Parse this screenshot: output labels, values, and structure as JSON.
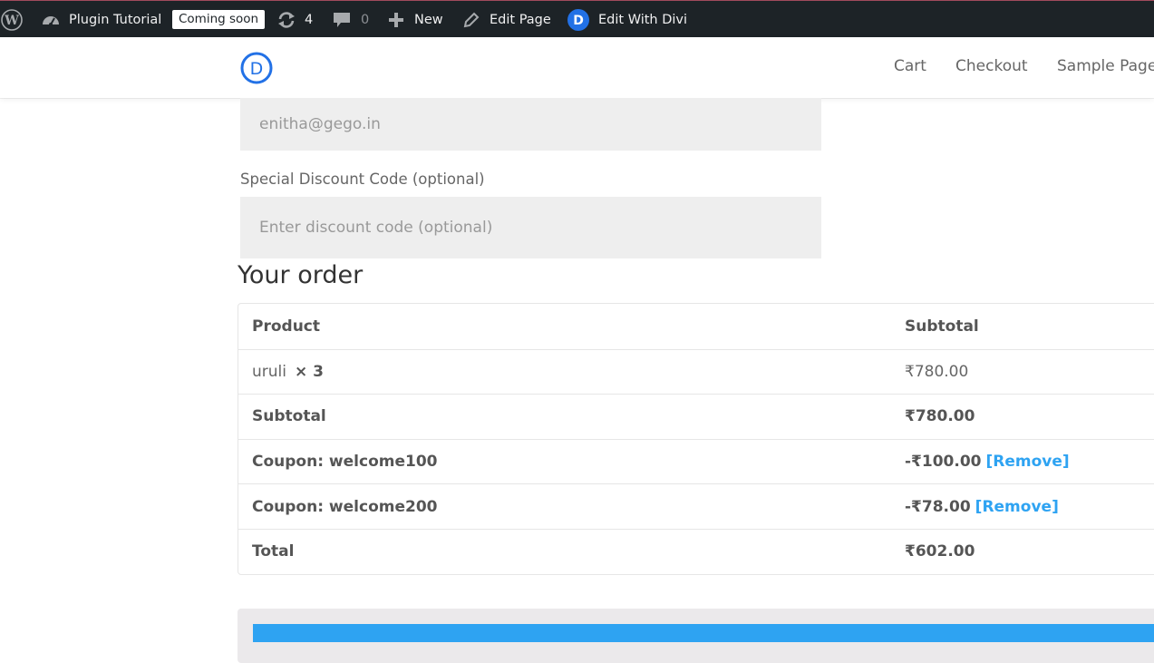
{
  "adminbar": {
    "site_name": "Plugin Tutorial",
    "coming_soon": "Coming soon",
    "updates_count": "4",
    "comments_count": "0",
    "new_label": "New",
    "edit_page_label": "Edit Page",
    "divi_label": "Edit With Divi",
    "colors": {
      "background": "#1d2327",
      "divi_blue": "#2271e6"
    }
  },
  "header": {
    "logo_letter": "D",
    "nav": [
      "Cart",
      "Checkout",
      "Sample Page"
    ]
  },
  "form": {
    "email_value": "enitha@gego.in",
    "discount_label": "Special Discount Code (optional)",
    "discount_placeholder": "Enter discount code (optional)"
  },
  "order": {
    "heading": "Your order",
    "col_product": "Product",
    "col_subtotal": "Subtotal",
    "item_name": "uruli",
    "item_qty": "× 3",
    "item_total": "₹780.00",
    "subtotal_label": "Subtotal",
    "subtotal_value": "₹780.00",
    "coupons": [
      {
        "label": "Coupon: welcome100",
        "amount": "-₹100.00",
        "remove": "[Remove]"
      },
      {
        "label": "Coupon: welcome200",
        "amount": "-₹78.00",
        "remove": "[Remove]"
      }
    ],
    "total_label": "Total",
    "total_value": "₹602.00"
  },
  "colors": {
    "accent": "#2ea3f2",
    "text": "#666666",
    "field_bg": "#eeeeee"
  }
}
